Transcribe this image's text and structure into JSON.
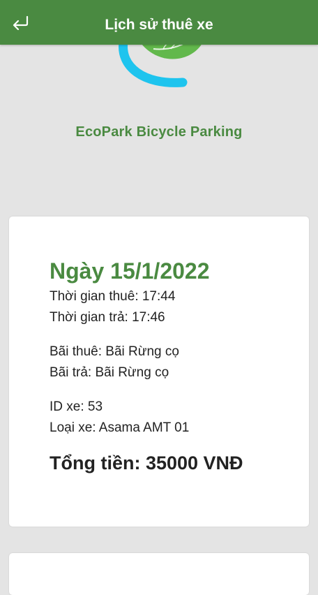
{
  "header": {
    "title": "Lịch sử thuê xe",
    "back_icon": "return-arrow-icon"
  },
  "brand": {
    "name": "EcoPark Bicycle Parking",
    "logo_icon": "ecopark-leaf-logo",
    "colors": {
      "leaf": "#62b84c",
      "ring": "#1ec4ee",
      "primary": "#4a8a41"
    }
  },
  "rentals": [
    {
      "date": "Ngày 15/1/2022",
      "rent_time": "Thời gian thuê: 17:44",
      "return_time": "Thời gian trả: 17:46",
      "rent_station": "Bãi thuê: Bãi Rừng cọ",
      "return_station": "Bãi trả: Bãi Rừng cọ",
      "bike_id": "ID xe: 53",
      "bike_type": "Loại xe: Asama AMT 01",
      "total": "Tổng tiền: 35000 VNĐ"
    }
  ]
}
